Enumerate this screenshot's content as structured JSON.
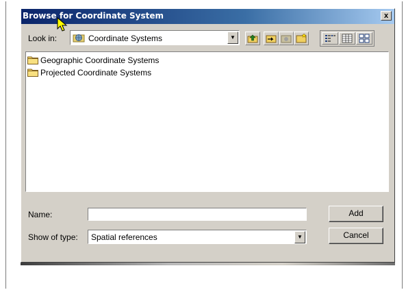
{
  "dialog": {
    "title": "Browse for Coordinate System",
    "close_label": "x"
  },
  "lookin": {
    "label": "Look in:",
    "value": "Coordinate Systems",
    "icon": "globe-folder-icon"
  },
  "toolbar": {
    "buttons": [
      {
        "name": "up-one-level-icon"
      },
      {
        "name": "connect-folder-icon"
      },
      {
        "name": "disconnect-folder-icon"
      },
      {
        "name": "new-folder-icon"
      },
      {
        "name": "list-view-icon"
      },
      {
        "name": "details-view-icon"
      },
      {
        "name": "thumbnails-view-icon"
      }
    ]
  },
  "list": {
    "items": [
      {
        "label": "Geographic Coordinate Systems",
        "icon": "folder-icon"
      },
      {
        "label": "Projected Coordinate Systems",
        "icon": "folder-icon"
      }
    ]
  },
  "form": {
    "name_label": "Name:",
    "name_value": "",
    "type_label": "Show of type:",
    "type_value": "Spatial references"
  },
  "buttons": {
    "add_label": "Add",
    "cancel_label": "Cancel"
  },
  "colors": {
    "title_bar": "#0a246a",
    "dialog_face": "#d4d0c8"
  }
}
